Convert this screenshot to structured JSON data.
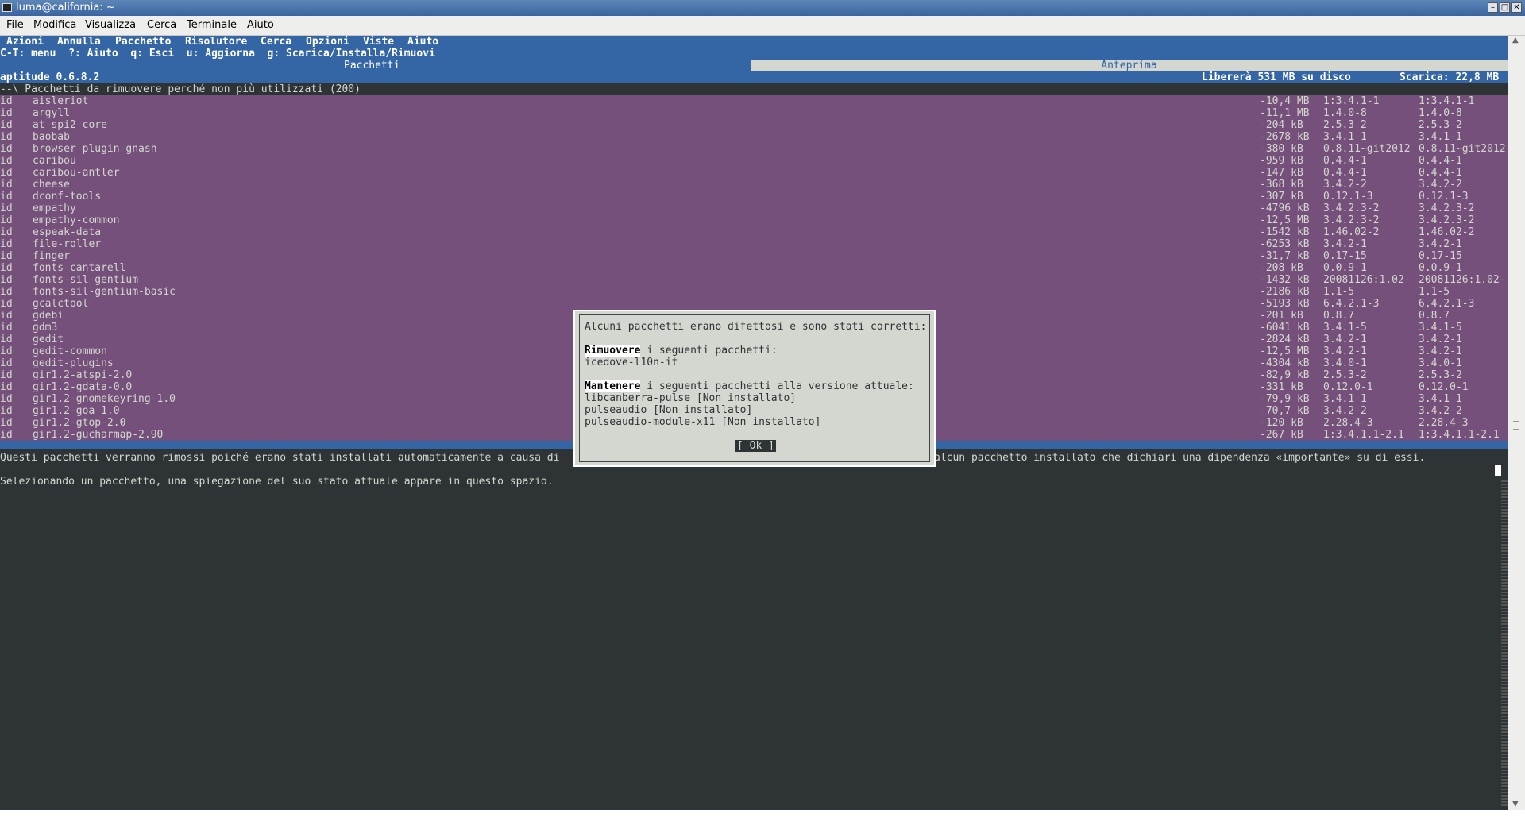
{
  "window": {
    "title": "luma@california: ~",
    "buttons": {
      "minimize": "–",
      "maximize": "□",
      "close": "✕"
    }
  },
  "menubar": [
    "File",
    "Modifica",
    "Visualizza",
    "Cerca",
    "Terminale",
    "Aiuto"
  ],
  "aptitude": {
    "menu": [
      "Azioni",
      "Annulla",
      "Pacchetto",
      "Risolutore",
      "Cerca",
      "Opzioni",
      "Viste",
      "Aiuto"
    ],
    "keys_line": "C-T: menu  ?: Aiuto  q: Esci  u: Aggiorna  g: Scarica/Installa/Rimuovi",
    "tabs": {
      "pacchetti": "Pacchetti",
      "anteprima": "Anteprima"
    },
    "version": "aptitude 0.6.8.2",
    "free_space": "Libererà 531 MB su disco",
    "download": "Scarica: 22,8 MB",
    "section_header": "--\\ Pacchetti da rimuovere perché non più utilizzati (200)",
    "packages": [
      {
        "flag": "id",
        "name": "aisleriot",
        "size": "-10,4 MB",
        "cur": "1:3.4.1-1",
        "new": "1:3.4.1-1"
      },
      {
        "flag": "id",
        "name": "argyll",
        "size": "-11,1 MB",
        "cur": "1.4.0-8",
        "new": "1.4.0-8"
      },
      {
        "flag": "id",
        "name": "at-spi2-core",
        "size": "-204 kB",
        "cur": "2.5.3-2",
        "new": "2.5.3-2"
      },
      {
        "flag": "id",
        "name": "baobab",
        "size": "-2678 kB",
        "cur": "3.4.1-1",
        "new": "3.4.1-1"
      },
      {
        "flag": "id",
        "name": "browser-plugin-gnash",
        "size": "-380 kB",
        "cur": "0.8.11~git2012",
        "new": "0.8.11~git2012"
      },
      {
        "flag": "id",
        "name": "caribou",
        "size": "-959 kB",
        "cur": "0.4.4-1",
        "new": "0.4.4-1"
      },
      {
        "flag": "id",
        "name": "caribou-antler",
        "size": "-147 kB",
        "cur": "0.4.4-1",
        "new": "0.4.4-1"
      },
      {
        "flag": "id",
        "name": "cheese",
        "size": "-368 kB",
        "cur": "3.4.2-2",
        "new": "3.4.2-2"
      },
      {
        "flag": "id",
        "name": "dconf-tools",
        "size": "-307 kB",
        "cur": "0.12.1-3",
        "new": "0.12.1-3"
      },
      {
        "flag": "id",
        "name": "empathy",
        "size": "-4796 kB",
        "cur": "3.4.2.3-2",
        "new": "3.4.2.3-2"
      },
      {
        "flag": "id",
        "name": "empathy-common",
        "size": "-12,5 MB",
        "cur": "3.4.2.3-2",
        "new": "3.4.2.3-2"
      },
      {
        "flag": "id",
        "name": "espeak-data",
        "size": "-1542 kB",
        "cur": "1.46.02-2",
        "new": "1.46.02-2"
      },
      {
        "flag": "id",
        "name": "file-roller",
        "size": "-6253 kB",
        "cur": "3.4.2-1",
        "new": "3.4.2-1"
      },
      {
        "flag": "id",
        "name": "finger",
        "size": "-31,7 kB",
        "cur": "0.17-15",
        "new": "0.17-15"
      },
      {
        "flag": "id",
        "name": "fonts-cantarell",
        "size": "-208 kB",
        "cur": "0.0.9-1",
        "new": "0.0.9-1"
      },
      {
        "flag": "id",
        "name": "fonts-sil-gentium",
        "size": "-1432 kB",
        "cur": "20081126:1.02-",
        "new": "20081126:1.02-"
      },
      {
        "flag": "id",
        "name": "fonts-sil-gentium-basic",
        "size": "-2186 kB",
        "cur": "1.1-5",
        "new": "1.1-5"
      },
      {
        "flag": "id",
        "name": "gcalctool",
        "size": "-5193 kB",
        "cur": "6.4.2.1-3",
        "new": "6.4.2.1-3"
      },
      {
        "flag": "id",
        "name": "gdebi",
        "size": "-201 kB",
        "cur": "0.8.7",
        "new": "0.8.7"
      },
      {
        "flag": "id",
        "name": "gdm3",
        "size": "-6041 kB",
        "cur": "3.4.1-5",
        "new": "3.4.1-5"
      },
      {
        "flag": "id",
        "name": "gedit",
        "size": "-2824 kB",
        "cur": "3.4.2-1",
        "new": "3.4.2-1"
      },
      {
        "flag": "id",
        "name": "gedit-common",
        "size": "-12,5 MB",
        "cur": "3.4.2-1",
        "new": "3.4.2-1"
      },
      {
        "flag": "id",
        "name": "gedit-plugins",
        "size": "-4304 kB",
        "cur": "3.4.0-1",
        "new": "3.4.0-1"
      },
      {
        "flag": "id",
        "name": "gir1.2-atspi-2.0",
        "size": "-82,9 kB",
        "cur": "2.5.3-2",
        "new": "2.5.3-2"
      },
      {
        "flag": "id",
        "name": "gir1.2-gdata-0.0",
        "size": "-331 kB",
        "cur": "0.12.0-1",
        "new": "0.12.0-1"
      },
      {
        "flag": "id",
        "name": "gir1.2-gnomekeyring-1.0",
        "size": "-79,9 kB",
        "cur": "3.4.1-1",
        "new": "3.4.1-1"
      },
      {
        "flag": "id",
        "name": "gir1.2-goa-1.0",
        "size": "-70,7 kB",
        "cur": "3.4.2-2",
        "new": "3.4.2-2"
      },
      {
        "flag": "id",
        "name": "gir1.2-gtop-2.0",
        "size": "-120 kB",
        "cur": "2.28.4-3",
        "new": "2.28.4-3"
      },
      {
        "flag": "id",
        "name": "gir1.2-gucharmap-2.90",
        "size": "-267 kB",
        "cur": "1:3.4.1.1-2.1",
        "new": "1:3.4.1.1-2.1"
      }
    ],
    "info_left": "Questi pacchetti verranno rimossi poiché erano stati installati automaticamente a causa di",
    "info_right": "alcun pacchetto installato che dichiari una dipendenza «importante» su di essi.",
    "hint": "Selezionando un pacchetto, una spiegazione del suo stato attuale appare in questo spazio."
  },
  "dialog": {
    "heading": "Alcuni pacchetti erano difettosi e sono stati corretti:",
    "remove_keyword": "Rimuovere",
    "remove_rest": " i seguenti pacchetti:",
    "remove_list": [
      "icedove-l10n-it"
    ],
    "keep_keyword": "Mantenere",
    "keep_rest": " i seguenti pacchetti alla versione attuale:",
    "keep_list": [
      "libcanberra-pulse [Non installato]",
      "pulseaudio [Non installato]",
      "pulseaudio-module-x11 [Non installato]"
    ],
    "ok": "[ Ok ]"
  }
}
